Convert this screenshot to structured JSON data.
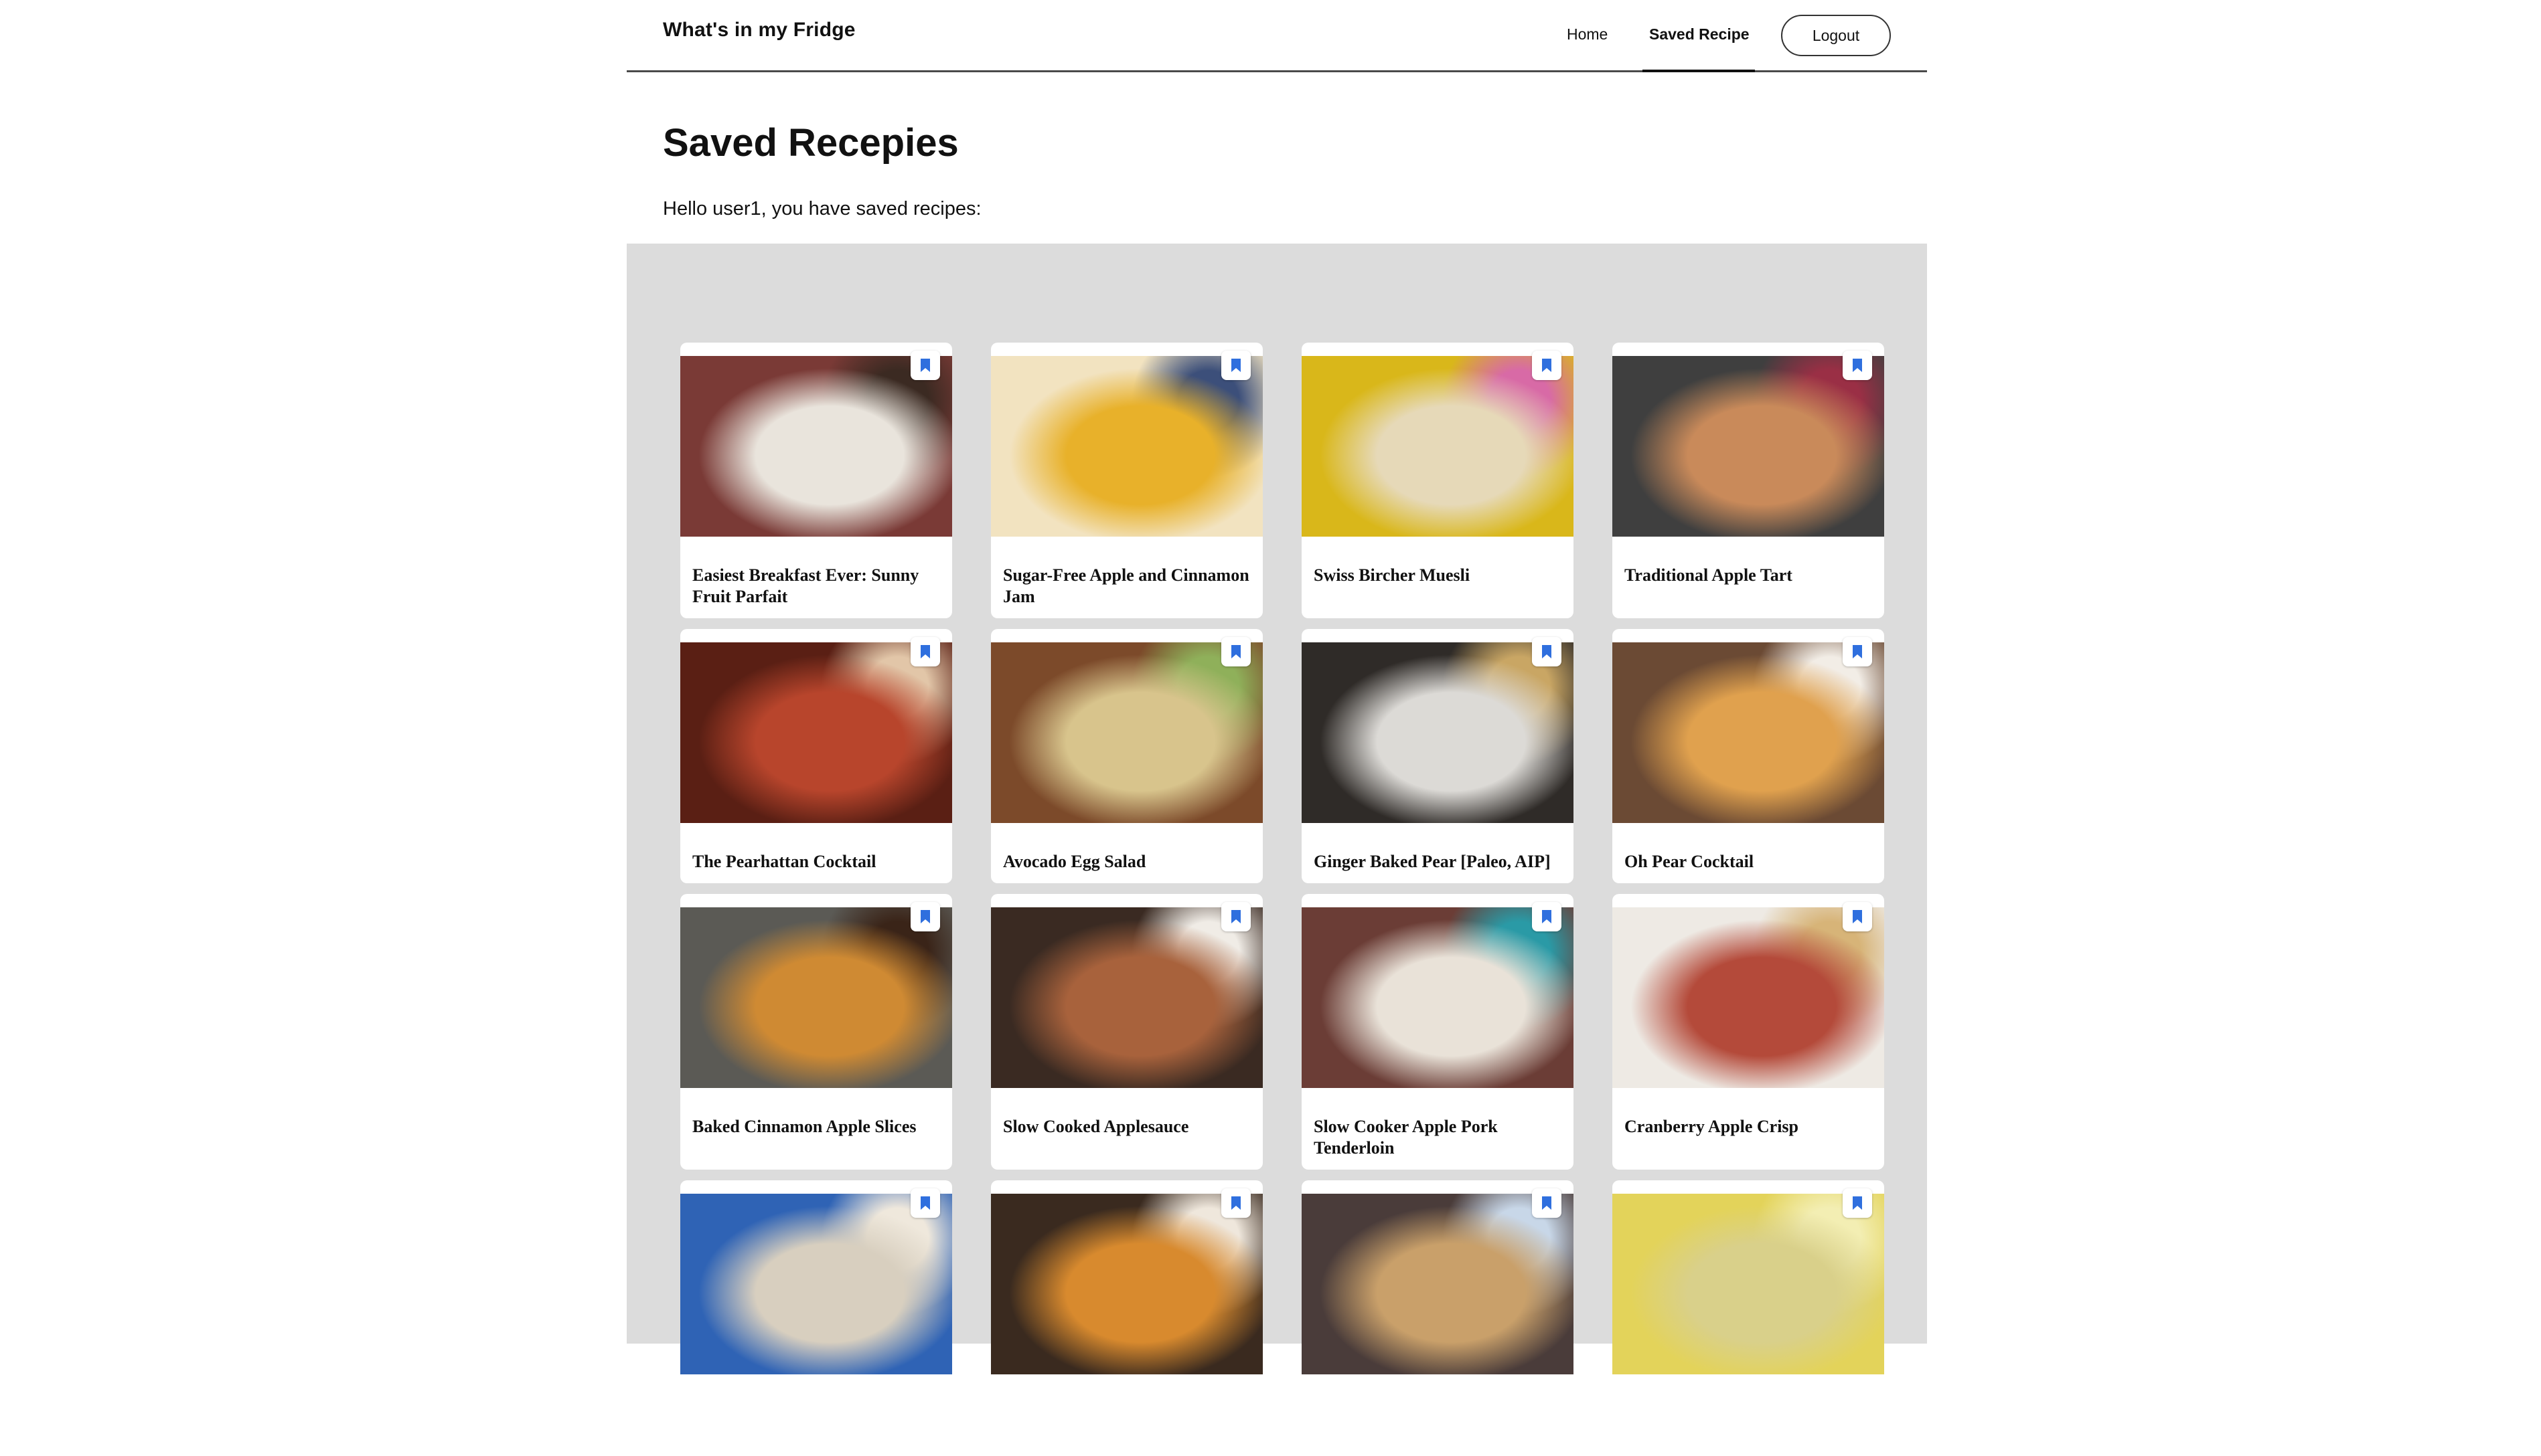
{
  "header": {
    "brand": "What's in my Fridge",
    "nav": {
      "home": "Home",
      "saved": "Saved Recipe",
      "logout": "Logout"
    }
  },
  "main": {
    "title": "Saved Recepies",
    "greeting": "Hello user1, you have saved recipes:"
  },
  "colors": {
    "accent": "#2f6fde",
    "panel": "#dcdcdc"
  },
  "icons": {
    "bookmark": "bookmark-icon"
  },
  "recipes": [
    {
      "title": "Easiest Breakfast Ever: Sunny Fruit Parfait",
      "palette": [
        "#7a3a36",
        "#e9e4dc",
        "#3b2a22"
      ]
    },
    {
      "title": "Sugar-Free Apple and Cinnamon Jam",
      "palette": [
        "#f2e3c0",
        "#e8b12a",
        "#3c4f7a"
      ]
    },
    {
      "title": "Swiss Bircher Muesli",
      "palette": [
        "#d9b71a",
        "#e6d9b8",
        "#d86aa6"
      ]
    },
    {
      "title": "Traditional Apple Tart",
      "palette": [
        "#3f3f3f",
        "#c98a5a",
        "#9a2f45"
      ]
    },
    {
      "title": "The Pearhattan Cocktail",
      "palette": [
        "#5a1f14",
        "#b8452c",
        "#e2c6a8"
      ]
    },
    {
      "title": "Avocado Egg Salad",
      "palette": [
        "#7c4a2a",
        "#d8c48c",
        "#8fb05a"
      ]
    },
    {
      "title": "Ginger Baked Pear [Paleo, AIP]",
      "palette": [
        "#2f2b28",
        "#dcdad6",
        "#c9a664"
      ]
    },
    {
      "title": "Oh Pear Cocktail",
      "palette": [
        "#6b4a34",
        "#e0a14e",
        "#f2ede6"
      ]
    },
    {
      "title": "Baked Cinnamon Apple Slices",
      "palette": [
        "#5b5a55",
        "#cf8a33",
        "#3a2418"
      ]
    },
    {
      "title": "Slow Cooked Applesauce",
      "palette": [
        "#3a2a22",
        "#a8623c",
        "#f0ece6"
      ]
    },
    {
      "title": "Slow Cooker Apple Pork Tenderloin",
      "palette": [
        "#6b3d36",
        "#e9e2d8",
        "#2a9aa6"
      ]
    },
    {
      "title": "Cranberry Apple Crisp",
      "palette": [
        "#eeeae4",
        "#b44a3a",
        "#d7b478"
      ]
    },
    {
      "title": "",
      "palette": [
        "#2f63b5",
        "#d8cfbf",
        "#efe8dc"
      ]
    },
    {
      "title": "",
      "palette": [
        "#3a2a1f",
        "#d88a2e",
        "#efe7dc"
      ]
    },
    {
      "title": "",
      "palette": [
        "#4a3c3a",
        "#c9a06a",
        "#c8d7e8"
      ]
    },
    {
      "title": "",
      "palette": [
        "#e3d35a",
        "#d9d08a",
        "#f3eeb3"
      ]
    }
  ]
}
